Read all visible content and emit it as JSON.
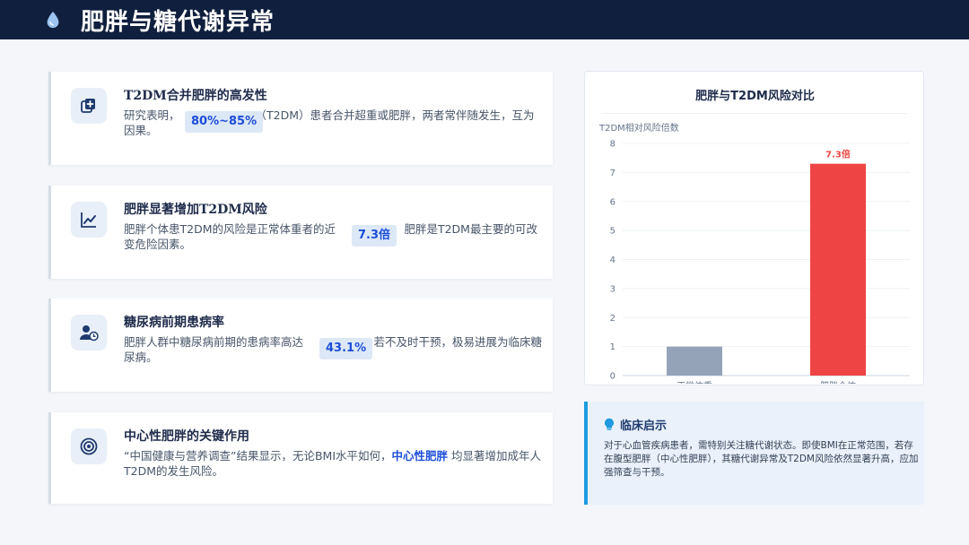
{
  "header": {
    "title": "肥胖与糖代谢异常",
    "icon": "water-drop-icon"
  },
  "cards": [
    {
      "icon": "medical-plus-icon",
      "title": "T2DM合并肥胖的高发性",
      "text_pre": "研究表明，",
      "highlight": "80%~85%",
      "text_post": "（T2DM）患者合并超重或肥胖，两者常伴随发生，互为因果。"
    },
    {
      "icon": "trend-up-icon",
      "title": "肥胖显著增加T2DM风险",
      "text_pre": "肥胖个体患T2DM的风险是正常体重者的近",
      "highlight": "7.3倍",
      "text_post": "，肥胖是T2DM最主要的可改变危险因素。"
    },
    {
      "icon": "user-clock-icon",
      "title": "糖尿病前期患病率",
      "text_pre": "肥胖人群中糖尿病前期的患病率高达",
      "highlight": "43.1%",
      "text_post": "，若不及时干预，极易进展为临床糖尿病。"
    },
    {
      "icon": "target-icon",
      "title": "中心性肥胖的关键作用",
      "text_pre": "“中国健康与营养调查”结果显示，无论BMI水平如何，",
      "highlight": "中心性肥胖",
      "text_post": " 均显著增加成年人T2DM的发生风险。"
    }
  ],
  "chart_data": {
    "type": "bar",
    "title": "肥胖与T2DM风险对比",
    "ylabel": "T2DM相对风险倍数",
    "categories": [
      "正常体重",
      "肥胖个体"
    ],
    "values": [
      1,
      7.3
    ],
    "data_labels": [
      "",
      "7.3倍"
    ],
    "colors": [
      "#94a3b8",
      "#ef4444"
    ],
    "ylim": [
      0,
      8
    ],
    "yticks": [
      "0",
      "1",
      "2",
      "3",
      "4",
      "5",
      "6",
      "7",
      "8"
    ],
    "grid": true
  },
  "insight": {
    "icon": "lightbulb-icon",
    "title": "临床启示",
    "text": "对于心血管疾病患者，需特别关注糖代谢状态。即使BMI在正常范围，若存在腹型肥胖（中心性肥胖），其糖代谢异常及T2DM风险依然显著升高，应加强筛查与干预。"
  },
  "colors": {
    "header_bg": "#0f1f3d",
    "accent": "#1d4ed8",
    "obese_bar": "#ef4444",
    "normal_bar": "#94a3b8"
  }
}
